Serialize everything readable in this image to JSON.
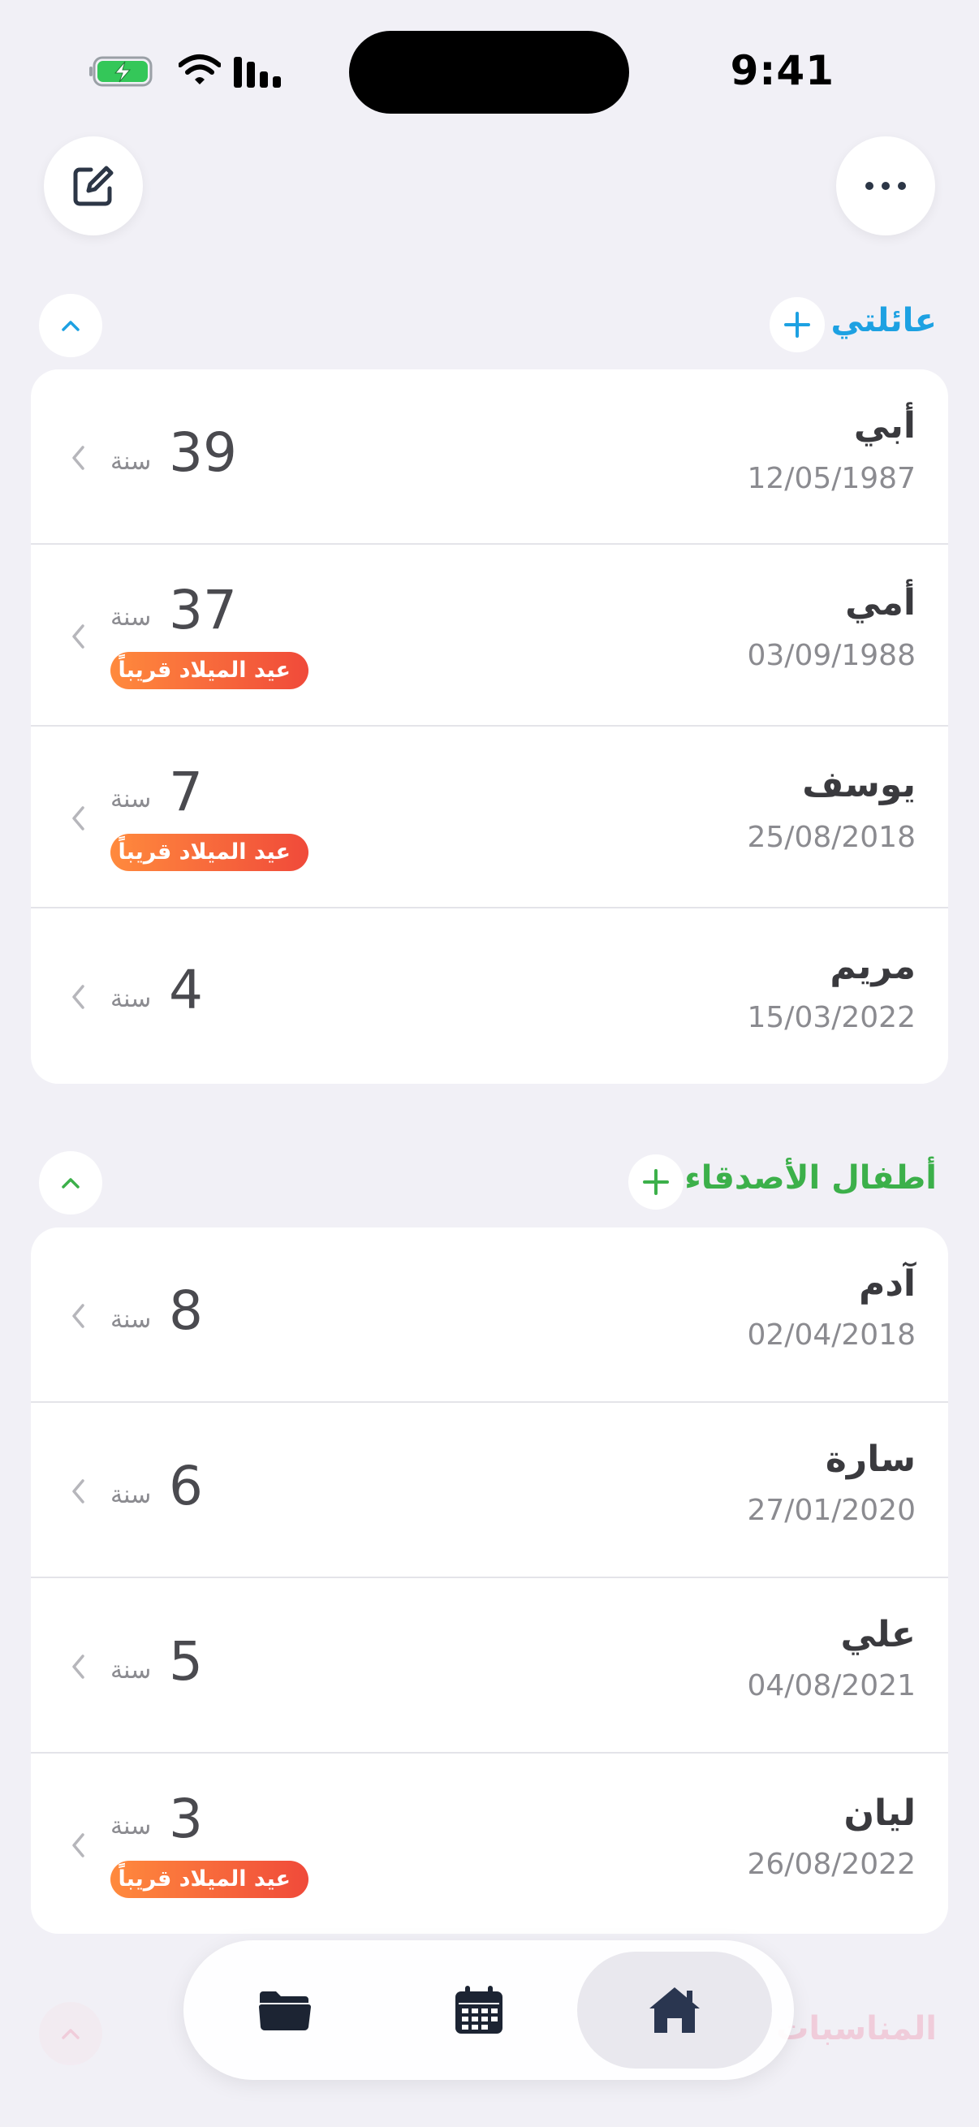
{
  "status": {
    "time": "9:41"
  },
  "colors": {
    "family_accent": "#1DA1E2",
    "friends_accent": "#3CB04A",
    "events_accent": "#F08AA8",
    "badge_start": "#F04A3A",
    "badge_end": "#FF8A3D"
  },
  "sections": [
    {
      "title": "عائلتي",
      "people": [
        {
          "name": "أبي",
          "date": "12/05/1987",
          "age": "39",
          "unit": "سنة",
          "badge": ""
        },
        {
          "name": "أمي",
          "date": "03/09/1988",
          "age": "37",
          "unit": "سنة",
          "badge": "عيد الميلاد قريباً"
        },
        {
          "name": "يوسف",
          "date": "25/08/2018",
          "age": "7",
          "unit": "سنة",
          "badge": "عيد الميلاد قريباً"
        },
        {
          "name": "مريم",
          "date": "15/03/2022",
          "age": "4",
          "unit": "سنة",
          "badge": ""
        }
      ]
    },
    {
      "title": "أطفال الأصدقاء",
      "people": [
        {
          "name": "آدم",
          "date": "02/04/2018",
          "age": "8",
          "unit": "سنة",
          "badge": ""
        },
        {
          "name": "سارة",
          "date": "27/01/2020",
          "age": "6",
          "unit": "سنة",
          "badge": ""
        },
        {
          "name": "علي",
          "date": "04/08/2021",
          "age": "5",
          "unit": "سنة",
          "badge": ""
        },
        {
          "name": "ليان",
          "date": "26/08/2022",
          "age": "3",
          "unit": "سنة",
          "badge": "عيد الميلاد قريباً"
        }
      ]
    },
    {
      "title": "المناسبات"
    }
  ],
  "tabs": {
    "icons": [
      "folder-icon",
      "calendar-icon",
      "home-icon"
    ],
    "active": "home"
  }
}
